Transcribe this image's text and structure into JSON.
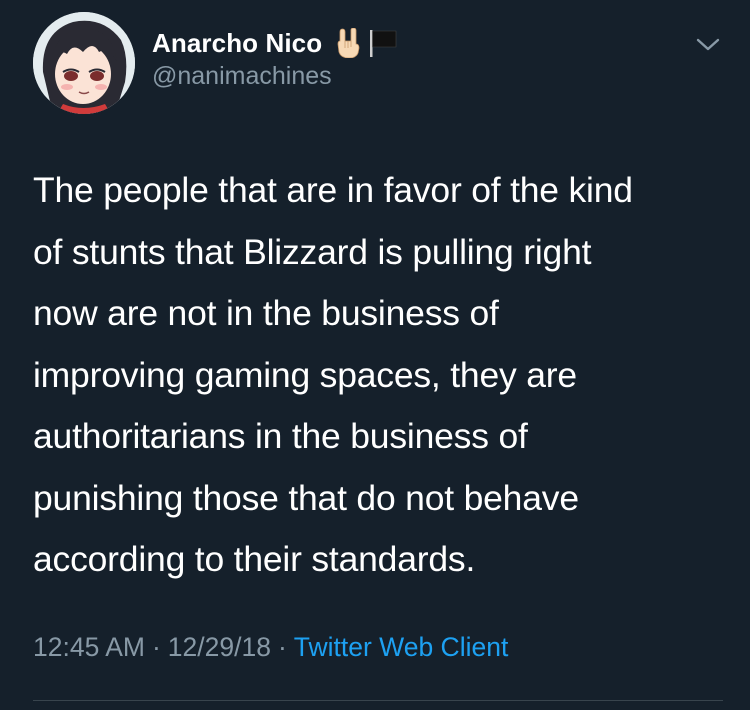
{
  "tweet": {
    "author": {
      "display_name": "Anarcho Nico",
      "handle": "@nanimachines",
      "name_emojis": [
        "sign-of-horns-icon",
        "black-flag-icon"
      ]
    },
    "text_lines": [
      "The people that are in favor of the kind",
      "of stunts that Blizzard is pulling right",
      "now are not in the business of",
      "improving gaming spaces, they are",
      "authoritarians in the business of",
      "punishing those that do not behave",
      "according to their standards."
    ],
    "time": "12:45 AM",
    "date": "12/29/18",
    "separator": "·",
    "client": "Twitter Web Client"
  },
  "colors": {
    "background": "#15202b",
    "text": "#ffffff",
    "secondary": "#8899a6",
    "link": "#1da1f2",
    "divider": "#38444d"
  }
}
